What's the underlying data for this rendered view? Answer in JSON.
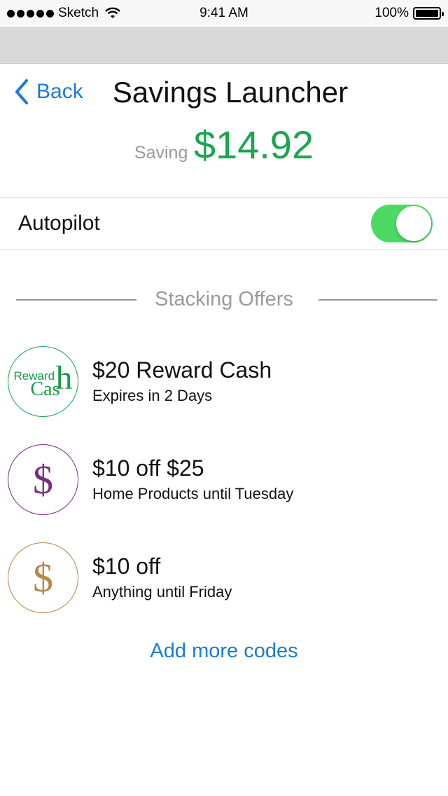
{
  "status_bar": {
    "carrier": "Sketch",
    "time": "9:41 AM",
    "battery": "100%"
  },
  "nav": {
    "back_label": "Back",
    "title": "Savings Launcher"
  },
  "saving": {
    "label": "Saving",
    "amount": "$14.92"
  },
  "autopilot": {
    "label": "Autopilot",
    "enabled": true
  },
  "section": {
    "title": "Stacking Offers"
  },
  "offers": [
    {
      "title": "$20 Reward Cash",
      "subtitle": "Expires in 2 Days",
      "icon": "reward-cash-logo",
      "logo_word1": "Reward",
      "logo_word2": "Cas",
      "logo_word3": "h",
      "color": "#1aa650"
    },
    {
      "title": "$10 off $25",
      "subtitle": "Home Products until Tuesday",
      "icon": "dollar-icon",
      "symbol": "$",
      "color": "#7b2d83"
    },
    {
      "title": "$10 off",
      "subtitle": "Anything until Friday",
      "icon": "dollar-icon",
      "symbol": "$",
      "color": "#b8874a"
    }
  ],
  "add_more_label": "Add more codes",
  "colors": {
    "accent": "#1a7bd6",
    "saving_green": "#1aa650",
    "toggle_on": "#4cd964"
  }
}
